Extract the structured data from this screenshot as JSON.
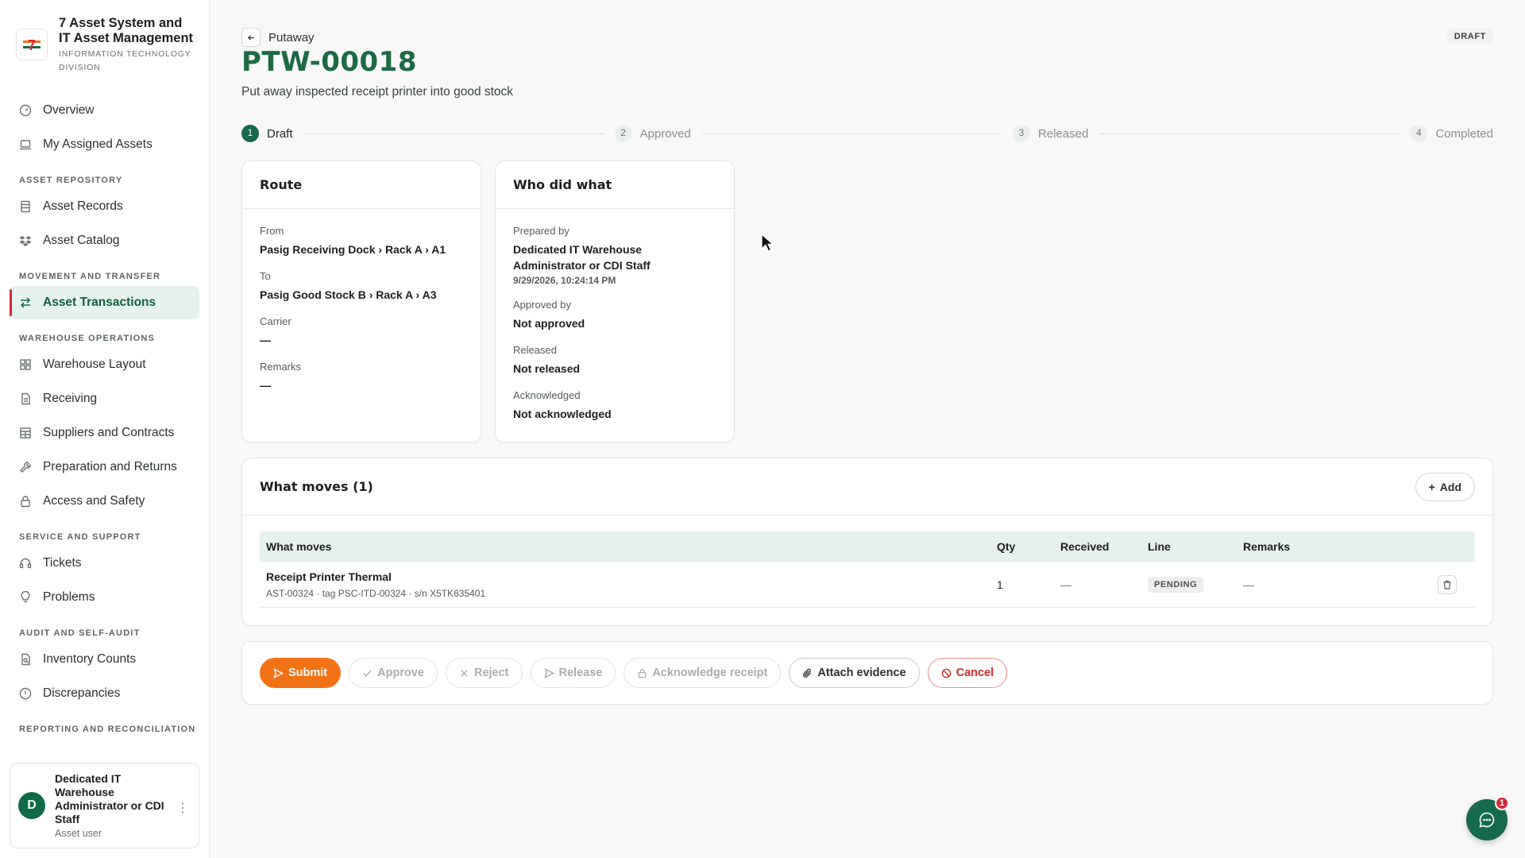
{
  "brand": {
    "title": "7 Asset System and IT Asset Management",
    "subtitle": "INFORMATION TECHNOLOGY DIVISION",
    "logo_text": "7"
  },
  "nav": {
    "overview": "Overview",
    "my_assets": "My Assigned Assets",
    "sec_repo": "ASSET REPOSITORY",
    "asset_records": "Asset Records",
    "asset_catalog": "Asset Catalog",
    "sec_movement": "MOVEMENT AND TRANSFER",
    "asset_transactions": "Asset Transactions",
    "sec_warehouse": "WAREHOUSE OPERATIONS",
    "warehouse_layout": "Warehouse Layout",
    "receiving": "Receiving",
    "suppliers": "Suppliers and Contracts",
    "prep_returns": "Preparation and Returns",
    "access_safety": "Access and Safety",
    "sec_service": "SERVICE AND SUPPORT",
    "tickets": "Tickets",
    "problems": "Problems",
    "sec_audit": "AUDIT AND SELF-AUDIT",
    "inventory_counts": "Inventory Counts",
    "discrepancies": "Discrepancies",
    "sec_reporting": "REPORTING AND RECONCILIATION"
  },
  "user": {
    "initial": "D",
    "name": "Dedicated IT Warehouse Administrator or CDI Staff",
    "role": "Asset user"
  },
  "page": {
    "breadcrumb": "Putaway",
    "title": "PTW-00018",
    "subtitle": "Put away inspected receipt printer into good stock",
    "status": "DRAFT"
  },
  "steps": [
    {
      "num": "1",
      "label": "Draft"
    },
    {
      "num": "2",
      "label": "Approved"
    },
    {
      "num": "3",
      "label": "Released"
    },
    {
      "num": "4",
      "label": "Completed"
    }
  ],
  "route": {
    "title": "Route",
    "from_label": "From",
    "from_value": "Pasig Receiving Dock › Rack A › A1",
    "to_label": "To",
    "to_value": "Pasig Good Stock B › Rack A › A3",
    "carrier_label": "Carrier",
    "carrier_value": "—",
    "remarks_label": "Remarks",
    "remarks_value": "—"
  },
  "who": {
    "title": "Who did what",
    "prepared_label": "Prepared by",
    "prepared_value": "Dedicated IT Warehouse Administrator or CDI Staff",
    "prepared_time": "9/29/2026, 10:24:14 PM",
    "approved_label": "Approved by",
    "approved_value": "Not approved",
    "released_label": "Released",
    "released_value": "Not released",
    "ack_label": "Acknowledged",
    "ack_value": "Not acknowledged"
  },
  "moves": {
    "title": "What moves (1)",
    "add_label": "Add",
    "columns": {
      "what": "What moves",
      "qty": "Qty",
      "received": "Received",
      "line": "Line",
      "remarks": "Remarks"
    },
    "rows": [
      {
        "name": "Receipt Printer Thermal",
        "meta": "AST-00324 · tag PSC-ITD-00324 · s/n X5TK635401",
        "qty": "1",
        "received": "—",
        "line": "PENDING",
        "remarks": "—"
      }
    ]
  },
  "actions": {
    "submit": "Submit",
    "approve": "Approve",
    "reject": "Reject",
    "release": "Release",
    "acknowledge": "Acknowledge receipt",
    "attach": "Attach evidence",
    "cancel": "Cancel"
  },
  "chat": {
    "badge": "1"
  },
  "colors": {
    "brand_green": "#16694a",
    "accent_orange": "#f47216",
    "danger_red": "#d02a2a",
    "active_bg": "#e6f2ed"
  }
}
